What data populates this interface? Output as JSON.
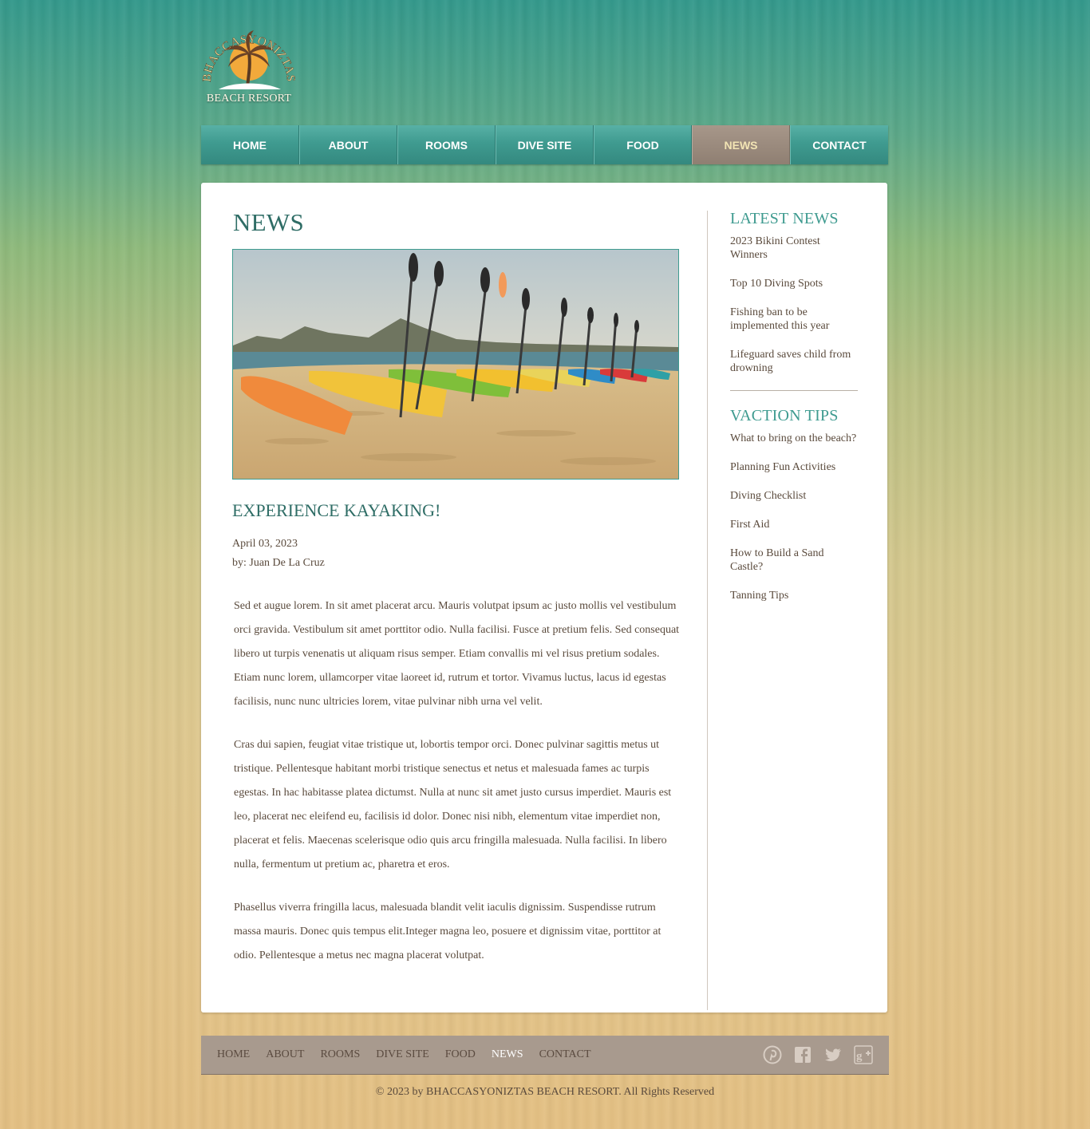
{
  "brand": {
    "arc_text": "BHACCASYONIZTAS",
    "sub_text": "BEACH RESORT"
  },
  "nav": {
    "items": [
      "HOME",
      "ABOUT",
      "ROOMS",
      "DIVE SITE",
      "FOOD",
      "NEWS",
      "CONTACT"
    ],
    "active": "NEWS"
  },
  "main": {
    "page_title": "NEWS",
    "hero_image": "kayaks-on-beach-photo",
    "article": {
      "title": "EXPERIENCE KAYAKING!",
      "date": "April 03, 2023",
      "author": "by: Juan De La Cruz",
      "paragraphs": [
        "Sed et augue lorem. In sit amet placerat arcu. Mauris volutpat ipsum ac justo mollis vel vestibulum orci gravida. Vestibulum sit amet porttitor odio. Nulla facilisi. Fusce at pretium felis. Sed consequat libero ut turpis venenatis ut aliquam risus semper. Etiam convallis mi vel risus pretium sodales. Etiam nunc lorem, ullamcorper vitae laoreet id, rutrum et tortor. Vivamus luctus, lacus id egestas facilisis, nunc nunc ultricies lorem, vitae pulvinar nibh urna vel velit.",
        "Cras dui sapien, feugiat vitae tristique ut, lobortis tempor orci. Donec pulvinar sagittis metus ut tristique. Pellentesque habitant morbi tristique senectus et netus et malesuada fames ac turpis egestas. In hac habitasse platea dictumst. Nulla at nunc sit amet justo cursus imperdiet. Mauris est leo, placerat nec eleifend eu, facilisis id dolor. Donec nisi nibh, elementum vitae imperdiet non, placerat et felis. Maecenas scelerisque odio quis arcu fringilla malesuada. Nulla facilisi. In libero nulla, fermentum ut pretium ac, pharetra et eros.",
        "Phasellus viverra fringilla lacus, malesuada blandit velit iaculis dignissim. Suspendisse rutrum massa mauris. Donec quis tempus elit.Integer magna leo, posuere et dignissim vitae, porttitor at odio. Pellentesque a metus nec magna placerat volutpat."
      ]
    }
  },
  "sidebar": {
    "latest_news": {
      "heading": "LATEST NEWS",
      "items": [
        "2023 Bikini Contest Winners",
        "Top 10 Diving Spots",
        "Fishing ban to be implemented this year",
        "Lifeguard saves child from drowning"
      ]
    },
    "vacation_tips": {
      "heading": "VACTION TIPS",
      "items": [
        "What to bring on the beach?",
        "Planning Fun Activities",
        "Diving Checklist",
        "First Aid",
        "How to Build a Sand Castle?",
        "Tanning Tips"
      ]
    }
  },
  "footer": {
    "nav": [
      "HOME",
      "ABOUT",
      "ROOMS",
      "DIVE SITE",
      "FOOD",
      "NEWS",
      "CONTACT"
    ],
    "active": "NEWS",
    "social_icons": [
      "pinterest-icon",
      "facebook-icon",
      "twitter-icon",
      "google-plus-icon"
    ],
    "copyright": "© 2023 by BHACCASYONIZTAS BEACH RESORT. All Rights Reserved"
  },
  "colors": {
    "accent_teal": "#3f9b90",
    "heading_teal": "#2f6d66",
    "active_nav_bg": "#8f7f72",
    "active_nav_text": "#f2e4b4",
    "body_text": "#5a4a3c",
    "footer_bg": "#a89a8e"
  }
}
